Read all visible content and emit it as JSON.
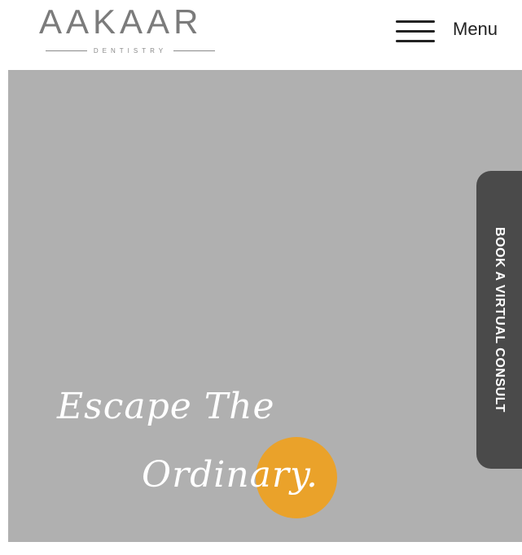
{
  "header": {
    "logo_text": "AAKAAR",
    "logo_subtext": "DENTISTRY",
    "menu_label": "Menu"
  },
  "hero": {
    "tagline_line1": "Escape The",
    "tagline_line2": "Ordinary.",
    "background_color": "#b0b0b0",
    "accent_color": "#eaa22a"
  },
  "consult_tab": {
    "label": "BOOK A VIRTUAL CONSULT"
  },
  "icons": {
    "menu": "hamburger-icon"
  }
}
